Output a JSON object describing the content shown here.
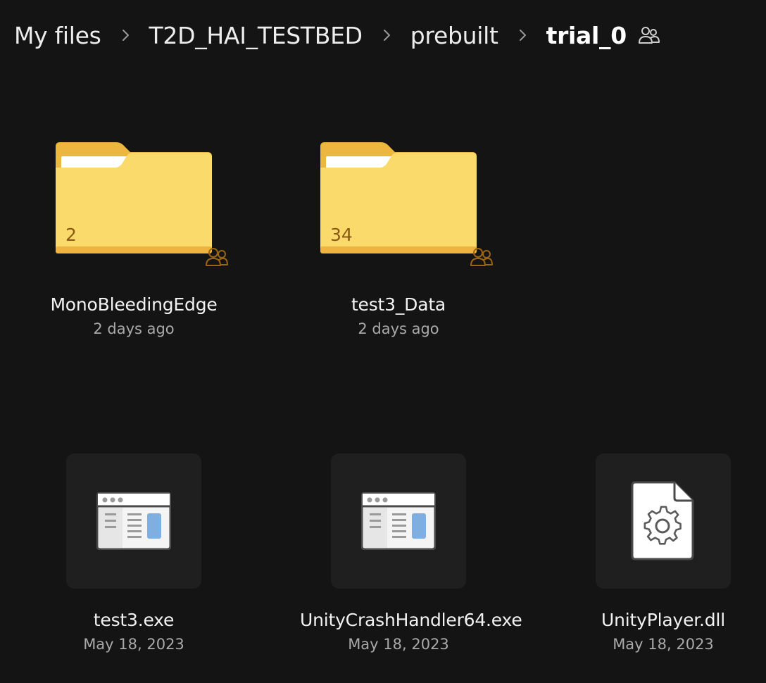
{
  "breadcrumb": {
    "items": [
      {
        "label": "My files"
      },
      {
        "label": "T2D_HAI_TESTBED"
      },
      {
        "label": "prebuilt"
      },
      {
        "label": "trial_0"
      }
    ],
    "current_icon": "shared-people-icon"
  },
  "folders": [
    {
      "name": "MonoBleedingEdge",
      "meta": "2 days ago",
      "count": "2",
      "icon": "shared-folder-icon"
    },
    {
      "name": "test3_Data",
      "meta": "2 days ago",
      "count": "34",
      "icon": "shared-folder-icon"
    }
  ],
  "files": [
    {
      "name": "test3.exe",
      "meta": "May 18, 2023",
      "icon": "app-window-icon"
    },
    {
      "name": "UnityCrashHandler64.exe",
      "meta": "May 18, 2023",
      "icon": "app-window-icon"
    },
    {
      "name": "UnityPlayer.dll",
      "meta": "May 18, 2023",
      "icon": "settings-file-icon"
    }
  ],
  "colors": {
    "background": "#141414",
    "folder_back": "#EDB63E",
    "folder_front": "#FBE17A",
    "folder_count": "#8A5A12",
    "tile_bg": "#1F1F1F",
    "meta_text": "#A9A9A9",
    "app_accent": "#7FAEE0"
  }
}
